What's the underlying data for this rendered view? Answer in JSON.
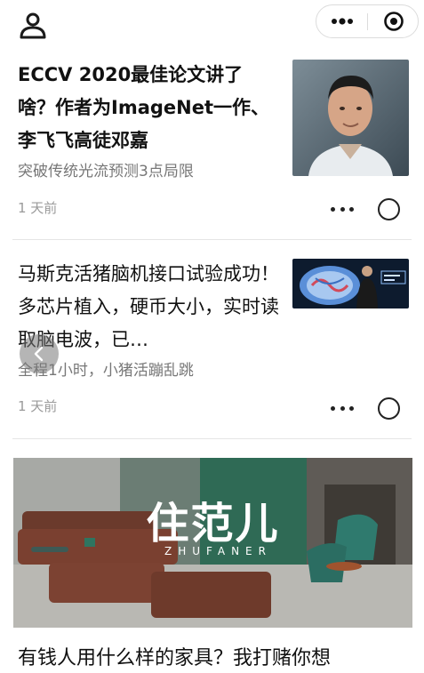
{
  "feed": {
    "articles": [
      {
        "title": "ECCV 2020最佳论文讲了啥？作者为ImageNet一作、李飞飞高徒邓嘉",
        "subtitle": "突破传统光流预测3点局限",
        "time": "1 天前",
        "thumbnail": "portrait-photo"
      },
      {
        "title": "马斯克活猪脑机接口试验成功！多芯片植入，硬币大小，实时读取脑电波，已…",
        "subtitle": "全程1小时，小猪活蹦乱跳",
        "time": "1 天前",
        "thumbnail": "brain-photo"
      }
    ],
    "banner": {
      "logo": "住范儿",
      "logo_sub": "ZHUFANER"
    },
    "bottom_title": "有钱人用什么样的家具？我打赌你想"
  },
  "icons": {
    "profile": "user-icon",
    "more": "more-dots-icon",
    "close": "target-icon",
    "back": "chevron-left-icon"
  }
}
